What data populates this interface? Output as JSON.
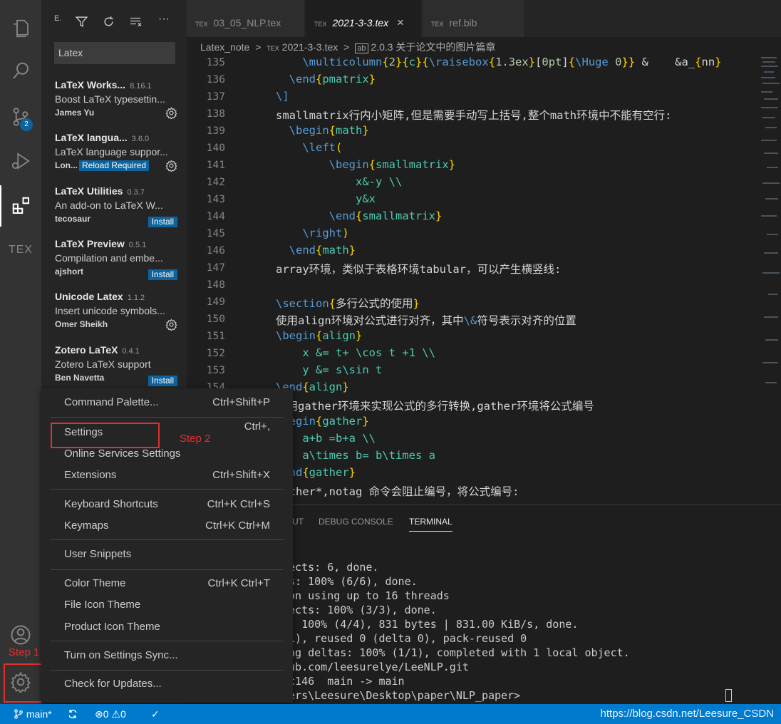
{
  "activity_bar": {
    "scm_badge": "2",
    "icons": [
      "explorer-icon",
      "search-icon",
      "source-control-icon",
      "run-debug-icon",
      "extensions-icon",
      "tex-icon",
      "account-icon",
      "manage-gear-icon"
    ],
    "tex_label": "TEX"
  },
  "sidebar": {
    "header": "E.",
    "search_value": "Latex",
    "extensions": [
      {
        "name": "LaTeX Works...",
        "version": "8.16.1",
        "desc": "Boost LaTeX typesettin...",
        "publisher": "James Yu",
        "action": ""
      },
      {
        "name": "LaTeX langua...",
        "version": "3.6.0",
        "desc": "LaTeX language suppor...",
        "publisher": "Lon...",
        "action": "Reload Required"
      },
      {
        "name": "LaTeX Utilities",
        "version": "0.3.7",
        "desc": "An add-on to LaTeX W...",
        "publisher": "tecosaur",
        "action": "Install"
      },
      {
        "name": "LaTeX Preview",
        "version": "0.5.1",
        "desc": "Compilation and embe...",
        "publisher": "ajshort",
        "action": "Install"
      },
      {
        "name": "Unicode Latex",
        "version": "1.1.2",
        "desc": "Insert unicode symbols...",
        "publisher": "Omer Sheikh",
        "action": ""
      },
      {
        "name": "Zotero LaTeX",
        "version": "0.4.1",
        "desc": "Zotero LaTeX support",
        "publisher": "Ben Navetta",
        "action": "Install"
      }
    ]
  },
  "tabs": [
    {
      "label": "03_05_NLP.tex",
      "prefix": "TEX"
    },
    {
      "label": "2021-3-3.tex",
      "prefix": "TEX",
      "close": "×"
    },
    {
      "label": "ref.bib",
      "prefix": "TEX"
    }
  ],
  "breadcrumb": {
    "folder": "Latex_note",
    "file": "2021-3-3.tex",
    "section": "2.0.3 关于论文中的图片篇章",
    "sep": ">"
  },
  "editor": {
    "line_numbers": [
      "135",
      "136",
      "137",
      "138",
      "139",
      "140",
      "141",
      "142",
      "143",
      "144",
      "145",
      "146",
      "147",
      "148",
      "149",
      "150",
      "151",
      "152",
      "153",
      "154"
    ]
  },
  "panel": {
    "tabs": [
      "UT",
      "DEBUG CONSOLE",
      "TERMINAL"
    ],
    "terminal_lines": [
      "jects: 6, done.",
      "ts: 100% (6/6), done.",
      "ion using up to 16 threads",
      "jects: 100% (3/3), done.",
      "s: 100% (4/4), 831 bytes | 831.00 KiB/s, done.",
      " 1), reused 0 (delta 0), pack-reused 0",
      "ing deltas: 100% (1/1), completed with 1 local object.",
      "hub.com/leesurelye/LeeNLP.git",
      "ec146  main -> main",
      "sers\\Leesure\\Desktop\\paper\\NLP_paper> "
    ]
  },
  "menu": {
    "groups": [
      [
        {
          "label": "Command Palette...",
          "key": "Ctrl+Shift+P"
        }
      ],
      [
        {
          "label": "Settings",
          "key": "Ctrl+,"
        },
        {
          "label": "Online Services Settings",
          "key": ""
        },
        {
          "label": "Extensions",
          "key": "Ctrl+Shift+X"
        }
      ],
      [
        {
          "label": "Keyboard Shortcuts",
          "key": "Ctrl+K Ctrl+S"
        },
        {
          "label": "Keymaps",
          "key": "Ctrl+K Ctrl+M"
        }
      ],
      [
        {
          "label": "User Snippets",
          "key": ""
        }
      ],
      [
        {
          "label": "Color Theme",
          "key": "Ctrl+K Ctrl+T"
        },
        {
          "label": "File Icon Theme",
          "key": ""
        },
        {
          "label": "Product Icon Theme",
          "key": ""
        }
      ],
      [
        {
          "label": "Turn on Settings Sync...",
          "key": ""
        }
      ],
      [
        {
          "label": "Check for Updates...",
          "key": ""
        }
      ]
    ]
  },
  "annotations": {
    "step1": "Step 1",
    "step2": "Step 2"
  },
  "statusbar": {
    "branch": "main*",
    "errors": "0",
    "warnings": "0",
    "watermark": "https://blog.csdn.net/Leesure_CSDN"
  }
}
